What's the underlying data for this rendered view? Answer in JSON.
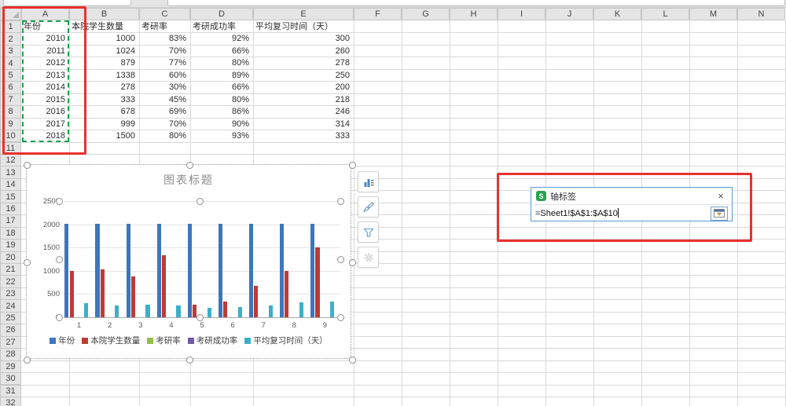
{
  "colors": {
    "annotation_red": "#e8322e",
    "selection_green": "#1aa050",
    "dialog_border": "#5b9bd5",
    "grid_line": "#d9d9d9",
    "header_bg": "#e5e5e5"
  },
  "spreadsheet": {
    "column_headers": [
      "A",
      "B",
      "C",
      "D",
      "E",
      "F",
      "G",
      "H",
      "I",
      "J",
      "K",
      "L",
      "M",
      "N"
    ],
    "row_numbers": [
      1,
      2,
      3,
      4,
      5,
      6,
      7,
      8,
      9,
      10,
      11,
      12,
      13,
      14,
      15,
      16,
      17,
      18,
      19,
      20,
      21,
      22,
      23,
      24,
      25,
      26,
      27,
      28,
      29,
      30,
      31,
      32
    ],
    "selection_range": "A1:A10",
    "table": {
      "headers": [
        "年份",
        "本院学生数量",
        "考研率",
        "考研成功率",
        "平均复习时间（天）"
      ],
      "rows": [
        [
          "2010",
          "1000",
          "83%",
          "92%",
          "300"
        ],
        [
          "2011",
          "1024",
          "70%",
          "66%",
          "260"
        ],
        [
          "2012",
          "879",
          "77%",
          "80%",
          "278"
        ],
        [
          "2013",
          "1338",
          "60%",
          "89%",
          "250"
        ],
        [
          "2014",
          "278",
          "30%",
          "66%",
          "200"
        ],
        [
          "2015",
          "333",
          "45%",
          "80%",
          "218"
        ],
        [
          "2016",
          "678",
          "69%",
          "86%",
          "246"
        ],
        [
          "2017",
          "999",
          "70%",
          "90%",
          "314"
        ],
        [
          "2018",
          "1500",
          "80%",
          "93%",
          "333"
        ]
      ]
    }
  },
  "chart_data": {
    "type": "bar",
    "title": "图表标题",
    "categories": [
      "1",
      "2",
      "3",
      "4",
      "5",
      "6",
      "7",
      "8",
      "9"
    ],
    "series": [
      {
        "name": "年份",
        "color": "#3d76bc",
        "values": [
          2010,
          2011,
          2012,
          2013,
          2014,
          2015,
          2016,
          2017,
          2018
        ]
      },
      {
        "name": "本院学生数量",
        "color": "#c03a35",
        "values": [
          1000,
          1024,
          879,
          1338,
          278,
          333,
          678,
          999,
          1500
        ]
      },
      {
        "name": "考研率",
        "color": "#94bd4a",
        "values": [
          0.83,
          0.7,
          0.77,
          0.6,
          0.3,
          0.45,
          0.69,
          0.7,
          0.8
        ]
      },
      {
        "name": "考研成功率",
        "color": "#715aa5",
        "values": [
          0.92,
          0.66,
          0.8,
          0.89,
          0.66,
          0.8,
          0.86,
          0.9,
          0.93
        ]
      },
      {
        "name": "平均复习时间（天）",
        "color": "#3eafc9",
        "values": [
          300,
          260,
          278,
          250,
          200,
          218,
          246,
          314,
          333
        ]
      }
    ],
    "ylim": [
      0,
      2500
    ],
    "yticks": [
      0,
      500,
      1000,
      1500,
      2000,
      2500
    ],
    "legend_position": "bottom",
    "grid": true
  },
  "chart_toolbar": {
    "buttons": [
      {
        "icon": "chart-elements-icon"
      },
      {
        "icon": "brush-icon"
      },
      {
        "icon": "funnel-icon"
      },
      {
        "icon": "gear-icon"
      }
    ]
  },
  "dialog": {
    "title": "轴标签",
    "input_value": "=Sheet1!$A$1:$A$10",
    "close_label": "×"
  }
}
